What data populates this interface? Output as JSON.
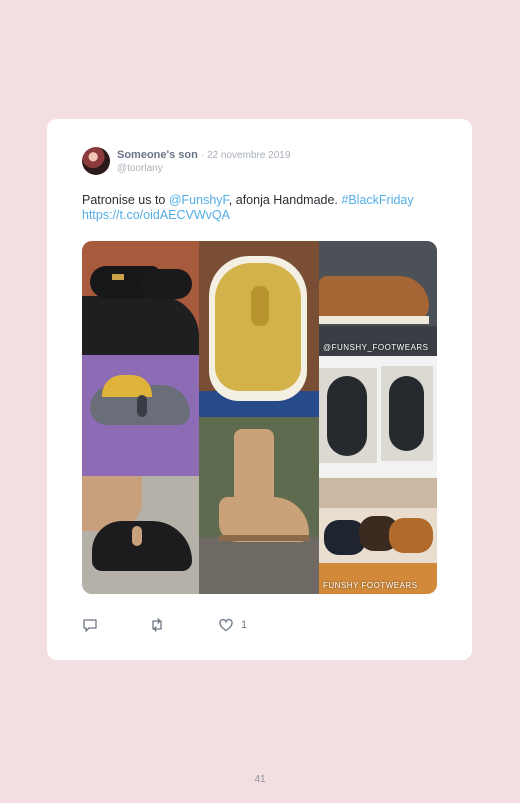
{
  "tweet": {
    "display_name": "Someone's son",
    "date": "· 22 novembre 2019",
    "handle": "@toorlany",
    "text_part1": "Patronise us to ",
    "mention": "@FunshyF",
    "text_part2": ", afonja Handmade. ",
    "hashtag": "#BlackFriday",
    "url": "https://t.co/oidAECVWvQA",
    "likes": "1"
  },
  "media": {
    "watermarks": {
      "tile3": "@FUNSHY_FOOTWEARS",
      "tile9": "FUNSHY FOOTWEARS"
    }
  },
  "icons": [
    "reply-icon",
    "retweet-icon",
    "like-icon"
  ],
  "colors": {
    "background": "#f3dfe1",
    "card": "#ffffff",
    "link": "#53aee8"
  },
  "page": {
    "number": "41"
  }
}
